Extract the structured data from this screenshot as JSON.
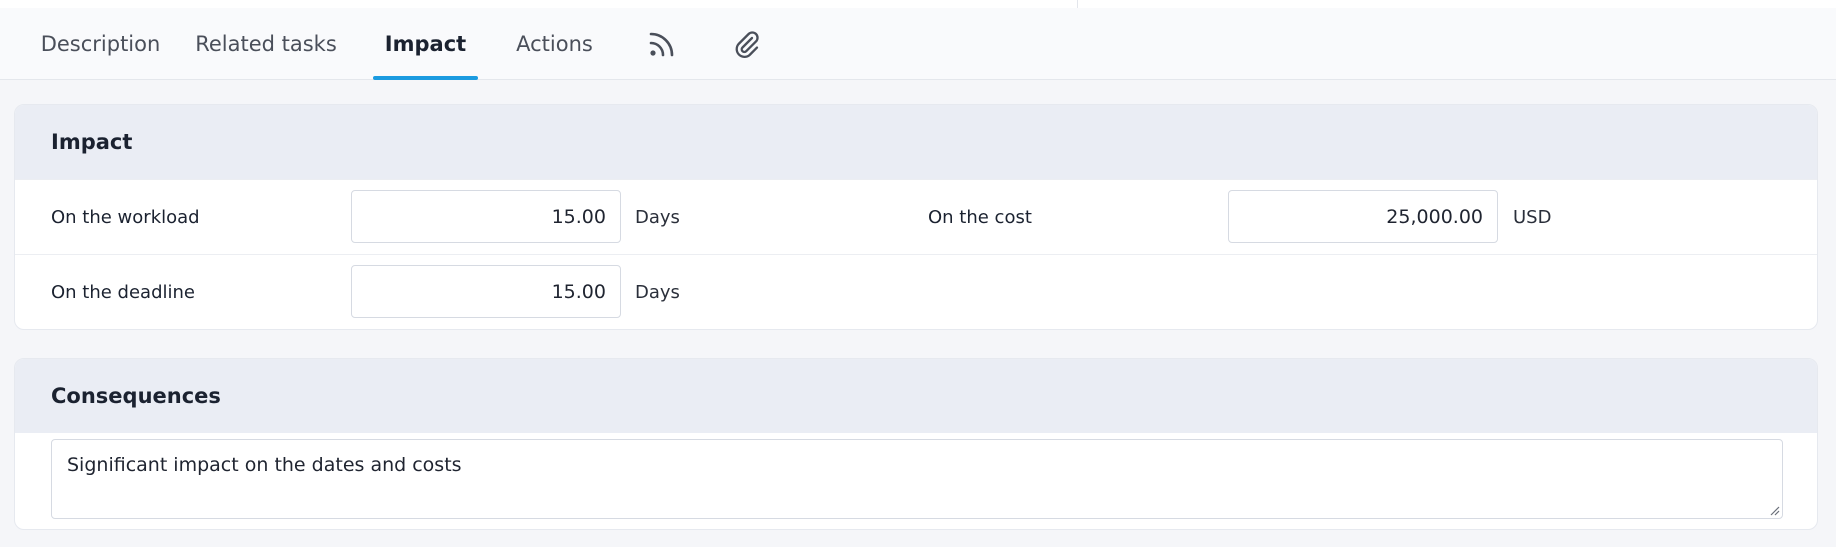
{
  "tabs": [
    {
      "label": "Description",
      "active": false
    },
    {
      "label": "Related tasks",
      "active": false
    },
    {
      "label": "Impact",
      "active": true
    },
    {
      "label": "Actions",
      "active": false
    }
  ],
  "tab_icons": [
    "rss-feed-icon",
    "paperclip-icon"
  ],
  "impact": {
    "title": "Impact",
    "workload": {
      "label": "On the workload",
      "value": "15.00",
      "unit": "Days"
    },
    "cost": {
      "label": "On the cost",
      "value": "25,000.00",
      "unit": "USD"
    },
    "deadline": {
      "label": "On the deadline",
      "value": "15.00",
      "unit": "Days"
    }
  },
  "consequences": {
    "title": "Consequences",
    "text": "Significant impact on the dates and costs"
  },
  "colors": {
    "accent": "#1b9be0",
    "card_header_bg": "#eaedf4",
    "page_bg": "#f5f6f9"
  }
}
